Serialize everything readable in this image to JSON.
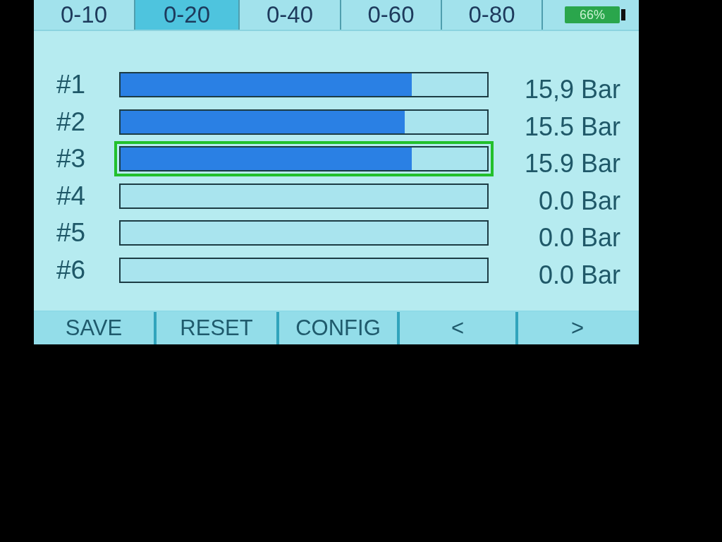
{
  "tabs": [
    {
      "label": "0-10",
      "selected": false
    },
    {
      "label": "0-20",
      "selected": true
    },
    {
      "label": "0-40",
      "selected": false
    },
    {
      "label": "0-60",
      "selected": false
    },
    {
      "label": "0-80",
      "selected": false
    }
  ],
  "battery": {
    "percent": "66%"
  },
  "channels": [
    {
      "label": "#1",
      "level": 0.795,
      "reading": "15,9 Bar",
      "selected": false
    },
    {
      "label": "#2",
      "level": 0.775,
      "reading": "15.5 Bar",
      "selected": false
    },
    {
      "label": "#3",
      "level": 0.795,
      "reading": "15.9 Bar",
      "selected": true
    },
    {
      "label": "#4",
      "level": 0,
      "reading": "0.0 Bar",
      "selected": false
    },
    {
      "label": "#5",
      "level": 0,
      "reading": "0.0 Bar",
      "selected": false
    },
    {
      "label": "#6",
      "level": 0,
      "reading": "0.0 Bar",
      "selected": false
    }
  ],
  "buttons": [
    "SAVE",
    "RESET",
    "CONFIG",
    "<",
    ">"
  ]
}
